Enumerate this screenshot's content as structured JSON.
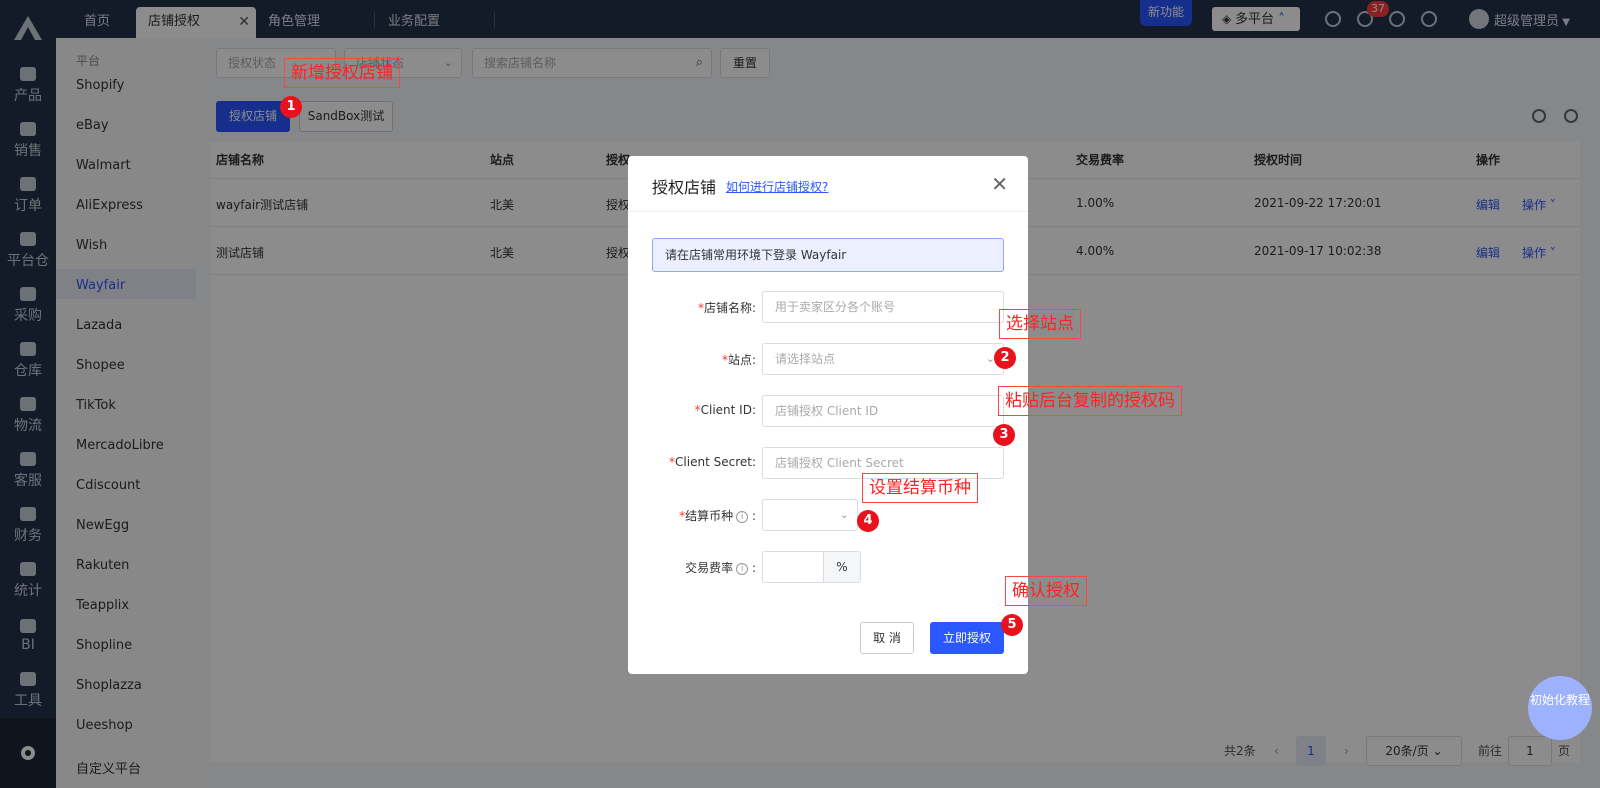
{
  "topbar": {
    "tabs": [
      {
        "label": "首页"
      },
      {
        "label": "店铺授权"
      },
      {
        "label": "角色管理"
      },
      {
        "label": "业务配置"
      }
    ],
    "new_feature": "新功能",
    "platform": "多平台",
    "notification_count": "37",
    "user": "超级管理员"
  },
  "rail": {
    "items": [
      "产品",
      "销售",
      "订单",
      "平台仓",
      "采购",
      "仓库",
      "物流",
      "客服",
      "财务",
      "统计",
      "BI",
      "工具"
    ]
  },
  "subnav": {
    "title": "平台",
    "items": [
      "Shopify",
      "eBay",
      "Walmart",
      "AliExpress",
      "Wish",
      "Wayfair",
      "Lazada",
      "Shopee",
      "TikTok",
      "MercadoLibre",
      "Cdiscount",
      "NewEgg",
      "Rakuten",
      "Teapplix",
      "Shopline",
      "Shoplazza",
      "Ueeshop",
      "自定义平台"
    ],
    "active": "Wayfair"
  },
  "filters": {
    "auth_status": "授权状态",
    "shop_status": "店铺状态",
    "search_placeholder": "搜索店铺名称",
    "reset": "重置"
  },
  "actions": {
    "authorize_shop": "授权店铺",
    "sandbox": "SandBox测试"
  },
  "table": {
    "headers": [
      "店铺名称",
      "站点",
      "授权",
      "交易费率",
      "授权时间",
      "操作"
    ],
    "rows": [
      {
        "name": "wayfair测试店铺",
        "site": "北美",
        "auth": "授权",
        "fee": "1.00%",
        "time": "2021-09-22 17:20:01",
        "edit": "编辑",
        "ops": "操作"
      },
      {
        "name": "测试店铺",
        "site": "北美",
        "auth": "授权",
        "fee": "4.00%",
        "time": "2021-09-17 10:02:38",
        "edit": "编辑",
        "ops": "操作"
      }
    ]
  },
  "pager": {
    "total": "共2条",
    "current": "1",
    "page_size": "20条/页",
    "goto_prefix": "前往",
    "goto_value": "1",
    "goto_suffix": "页"
  },
  "modal": {
    "title": "授权店铺",
    "help_link": "如何进行店铺授权?",
    "notice": "请在店铺常用环境下登录 Wayfair",
    "fields": {
      "shop_name_label": "店铺名称:",
      "shop_name_placeholder": "用于卖家区分各个账号",
      "site_label": "站点:",
      "site_placeholder": "请选择站点",
      "client_id_label": "Client ID:",
      "client_id_placeholder": "店铺授权 Client ID",
      "client_secret_label": "Client Secret:",
      "client_secret_placeholder": "店铺授权 Client Secret",
      "currency_label": "结算币种",
      "fee_label": "交易费率",
      "fee_unit": "%"
    },
    "cancel": "取 消",
    "confirm": "立即授权"
  },
  "annotations": [
    {
      "num": "1",
      "text": "新增授权店铺"
    },
    {
      "num": "2",
      "text": "选择站点"
    },
    {
      "num": "3",
      "text": "粘贴后台复制的授权码"
    },
    {
      "num": "4",
      "text": "设置结算币种"
    },
    {
      "num": "5",
      "text": "确认授权"
    }
  ],
  "help_float": "初始化教程",
  "colors": {
    "primary": "#2b57ff",
    "rail": "#263249",
    "annotation": "#e8121c"
  }
}
